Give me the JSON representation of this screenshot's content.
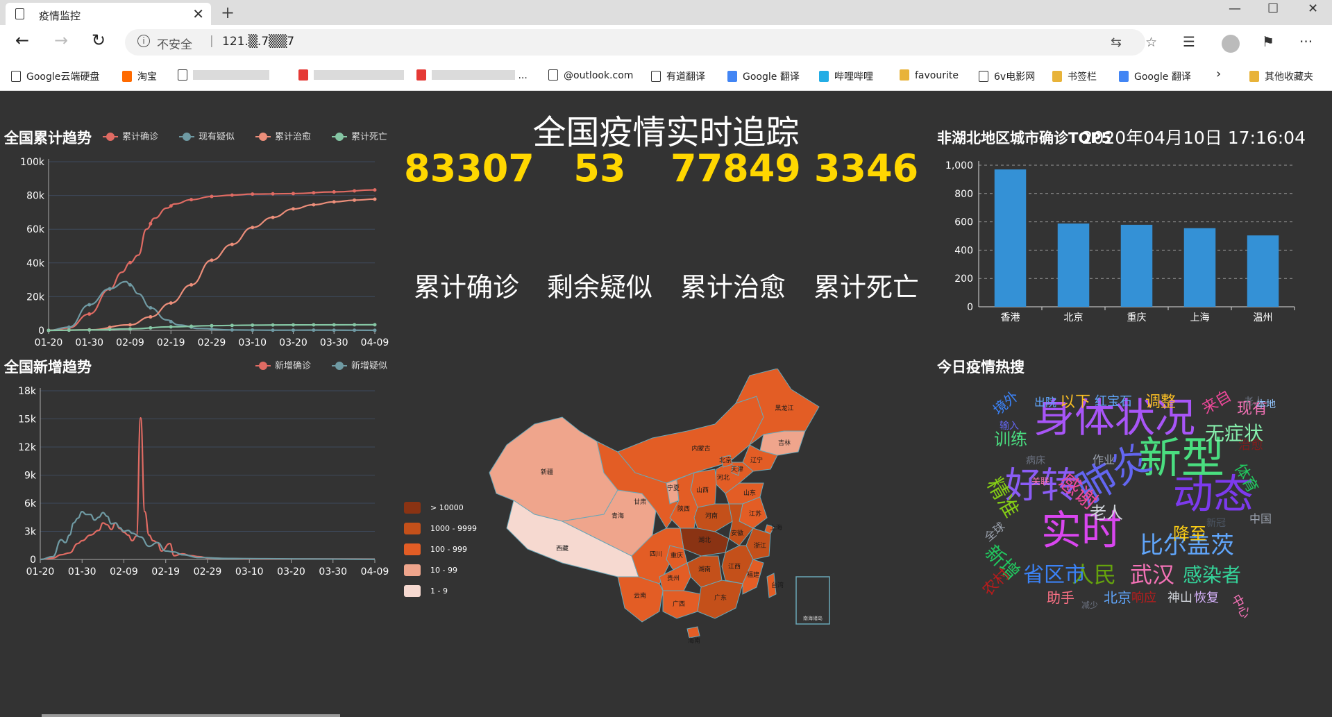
{
  "browser": {
    "tab_title": "疫情监控",
    "address": {
      "security": "不安全",
      "url": "121.▒.7▒▒7"
    },
    "bookmarks": [
      {
        "label": "Google云端硬盘",
        "icon": "doc-icon"
      },
      {
        "label": "淘宝",
        "icon": "taobao-icon"
      },
      {
        "label": "",
        "icon": "doc-icon",
        "redacted": true
      },
      {
        "label": "",
        "icon": "red-icon",
        "redacted": true
      },
      {
        "label": "...",
        "icon": "red-icon",
        "redacted": true
      },
      {
        "label": "@outlook.com",
        "icon": "doc-icon"
      },
      {
        "label": "有道翻译",
        "icon": "doc-icon"
      },
      {
        "label": "Google 翻译",
        "icon": "translate-icon"
      },
      {
        "label": "哔哩哔哩",
        "icon": "bilibili-icon"
      },
      {
        "label": "favourite",
        "icon": "folder-icon"
      },
      {
        "label": "6v电影网",
        "icon": "doc-icon"
      },
      {
        "label": "书签栏",
        "icon": "folder-icon"
      },
      {
        "label": "Google 翻译",
        "icon": "translate-icon"
      }
    ],
    "more_bookmarks": "其他收藏夹"
  },
  "header": {
    "title": "全国疫情实时追踪",
    "datetime": "2020年04月10日 17:16:04"
  },
  "stats": [
    {
      "value": "83307",
      "label": "累计确诊"
    },
    {
      "value": "53",
      "label": "剩余疑似"
    },
    {
      "value": "77849",
      "label": "累计治愈"
    },
    {
      "value": "3346",
      "label": "累计死亡"
    }
  ],
  "colors": {
    "confirmed": "#e06b63",
    "suspect": "#6f9aa3",
    "cured": "#ec8e7a",
    "dead": "#85c6a4",
    "bar": "#3491d6",
    "background": "#333333",
    "number": "#ffd700"
  },
  "panels": {
    "cumulative_title": "全国累计趋势",
    "daily_title": "全国新增趋势",
    "top5_title": "非湖北地区城市确诊TOP5",
    "hot_title": "今日疫情热搜"
  },
  "chart_data": [
    {
      "id": "cumulative",
      "type": "line",
      "title": "全国累计趋势",
      "x_ticks": [
        "01-20",
        "01-30",
        "02-09",
        "02-19",
        "02-29",
        "03-10",
        "03-20",
        "03-30",
        "04-09"
      ],
      "y_ticks": [
        "0",
        "20k",
        "40k",
        "60k",
        "80k",
        "100k"
      ],
      "ylim": [
        0,
        100000
      ],
      "xlim_days": [
        0,
        80
      ],
      "series": [
        {
          "name": "累计确诊",
          "color_key": "confirmed",
          "points": [
            [
              0,
              0
            ],
            [
              5,
              1500
            ],
            [
              10,
              9700
            ],
            [
              15,
              24500
            ],
            [
              18,
              34500
            ],
            [
              20,
              40200
            ],
            [
              22,
              44600
            ],
            [
              24,
              60000
            ],
            [
              26,
              66500
            ],
            [
              29,
              72500
            ],
            [
              31,
              75000
            ],
            [
              35,
              77500
            ],
            [
              40,
              79400
            ],
            [
              45,
              80200
            ],
            [
              50,
              80800
            ],
            [
              60,
              81100
            ],
            [
              70,
              82100
            ],
            [
              80,
              83300
            ]
          ]
        },
        {
          "name": "现有疑似",
          "color_key": "suspect",
          "points": [
            [
              0,
              0
            ],
            [
              5,
              1900
            ],
            [
              10,
              15200
            ],
            [
              15,
              24700
            ],
            [
              19,
              28900
            ],
            [
              20,
              27000
            ],
            [
              22,
              21700
            ],
            [
              25,
              13400
            ],
            [
              29,
              6200
            ],
            [
              32,
              3200
            ],
            [
              37,
              1100
            ],
            [
              45,
              250
            ],
            [
              55,
              100
            ],
            [
              65,
              150
            ],
            [
              80,
              53
            ]
          ]
        },
        {
          "name": "累计治愈",
          "color_key": "cured",
          "points": [
            [
              0,
              0
            ],
            [
              10,
              300
            ],
            [
              20,
              3300
            ],
            [
              25,
              8000
            ],
            [
              30,
              16200
            ],
            [
              35,
              27000
            ],
            [
              40,
              41600
            ],
            [
              45,
              51000
            ],
            [
              50,
              61000
            ],
            [
              55,
              67000
            ],
            [
              60,
              72000
            ],
            [
              65,
              74500
            ],
            [
              70,
              76200
            ],
            [
              75,
              77200
            ],
            [
              80,
              77800
            ]
          ]
        },
        {
          "name": "累计死亡",
          "color_key": "dead",
          "points": [
            [
              0,
              0
            ],
            [
              10,
              260
            ],
            [
              20,
              900
            ],
            [
              30,
              2100
            ],
            [
              40,
              2800
            ],
            [
              50,
              3100
            ],
            [
              60,
              3250
            ],
            [
              70,
              3300
            ],
            [
              80,
              3346
            ]
          ]
        }
      ]
    },
    {
      "id": "daily",
      "type": "line",
      "title": "全国新增趋势",
      "x_ticks": [
        "01-20",
        "01-30",
        "02-09",
        "02-19",
        "02-29",
        "03-10",
        "03-20",
        "03-30",
        "04-09"
      ],
      "y_ticks": [
        "0",
        "3k",
        "6k",
        "9k",
        "12k",
        "15k",
        "18k"
      ],
      "ylim": [
        0,
        18000
      ],
      "xlim_days": [
        0,
        80
      ],
      "series": [
        {
          "name": "新增确诊",
          "color_key": "confirmed",
          "points": [
            [
              0,
              0
            ],
            [
              3,
              150
            ],
            [
              5,
              500
            ],
            [
              7,
              700
            ],
            [
              9,
              1700
            ],
            [
              10,
              2000
            ],
            [
              12,
              2600
            ],
            [
              14,
              3100
            ],
            [
              15,
              3900
            ],
            [
              16,
              3700
            ],
            [
              17,
              3200
            ],
            [
              18,
              3900
            ],
            [
              19,
              3300
            ],
            [
              20,
              2900
            ],
            [
              21,
              2600
            ],
            [
              22,
              2000
            ],
            [
              23,
              2500
            ],
            [
              24,
              15100
            ],
            [
              25,
              5100
            ],
            [
              26,
              2600
            ],
            [
              27,
              2000
            ],
            [
              28,
              1800
            ],
            [
              29,
              900
            ],
            [
              31,
              1700
            ],
            [
              32,
              400
            ],
            [
              34,
              600
            ],
            [
              36,
              400
            ],
            [
              38,
              300
            ],
            [
              40,
              150
            ],
            [
              45,
              100
            ],
            [
              50,
              50
            ],
            [
              60,
              40
            ],
            [
              70,
              50
            ],
            [
              80,
              40
            ]
          ]
        },
        {
          "name": "新增疑似",
          "color_key": "suspect",
          "points": [
            [
              0,
              0
            ],
            [
              3,
              300
            ],
            [
              5,
              2100
            ],
            [
              6,
              1800
            ],
            [
              7,
              2600
            ],
            [
              8,
              3900
            ],
            [
              9,
              4400
            ],
            [
              10,
              5100
            ],
            [
              11,
              4800
            ],
            [
              12,
              4800
            ],
            [
              13,
              4200
            ],
            [
              14,
              4500
            ],
            [
              15,
              5000
            ],
            [
              16,
              4600
            ],
            [
              17,
              3800
            ],
            [
              18,
              3900
            ],
            [
              19,
              3400
            ],
            [
              20,
              3000
            ],
            [
              21,
              3100
            ],
            [
              22,
              2800
            ],
            [
              24,
              2400
            ],
            [
              26,
              1400
            ],
            [
              28,
              1800
            ],
            [
              30,
              900
            ],
            [
              32,
              800
            ],
            [
              34,
              500
            ],
            [
              38,
              200
            ],
            [
              45,
              100
            ],
            [
              60,
              60
            ],
            [
              70,
              40
            ],
            [
              80,
              20
            ]
          ]
        }
      ]
    },
    {
      "id": "top5",
      "type": "bar",
      "title": "非湖北地区城市确诊TOP5",
      "categories": [
        "香港",
        "北京",
        "重庆",
        "上海",
        "温州"
      ],
      "values": [
        970,
        588,
        579,
        555,
        504
      ],
      "y_ticks": [
        "0",
        "200",
        "400",
        "600",
        "800",
        "1,000"
      ],
      "ylim": [
        0,
        1000
      ]
    }
  ],
  "map": {
    "legend": [
      {
        "label": "> 10000",
        "color": "#8a3313"
      },
      {
        "label": "1000 - 9999",
        "color": "#c4501a"
      },
      {
        "label": "100 - 999",
        "color": "#e35d25"
      },
      {
        "label": "10 - 99",
        "color": "#efa58c"
      },
      {
        "label": "1 - 9",
        "color": "#f6d9d0"
      }
    ],
    "provinces": [
      {
        "name": "新疆",
        "level": 3
      },
      {
        "name": "西藏",
        "level": 4
      },
      {
        "name": "青海",
        "level": 3
      },
      {
        "name": "甘肃",
        "level": 2
      },
      {
        "name": "内蒙古",
        "level": 2
      },
      {
        "name": "黑龙江",
        "level": 2
      },
      {
        "name": "吉林",
        "level": 3
      },
      {
        "name": "辽宁",
        "level": 2
      },
      {
        "name": "北京",
        "level": 2
      },
      {
        "name": "天津",
        "level": 2
      },
      {
        "name": "河北",
        "level": 2
      },
      {
        "name": "山西",
        "level": 2
      },
      {
        "name": "宁夏",
        "level": 3
      },
      {
        "name": "陕西",
        "level": 2
      },
      {
        "name": "河南",
        "level": 1
      },
      {
        "name": "山东",
        "level": 2
      },
      {
        "name": "江苏",
        "level": 2
      },
      {
        "name": "安徽",
        "level": 1
      },
      {
        "name": "上海",
        "level": 2
      },
      {
        "name": "湖北",
        "level": 0
      },
      {
        "name": "四川",
        "level": 2
      },
      {
        "name": "重庆",
        "level": 2
      },
      {
        "name": "浙江",
        "level": 1
      },
      {
        "name": "湖南",
        "level": 1
      },
      {
        "name": "江西",
        "level": 1
      },
      {
        "name": "贵州",
        "level": 2
      },
      {
        "name": "云南",
        "level": 2
      },
      {
        "name": "广西",
        "level": 2
      },
      {
        "name": "广东",
        "level": 1
      },
      {
        "name": "福建",
        "level": 2
      },
      {
        "name": "台湾",
        "level": 2
      },
      {
        "name": "海南",
        "level": 2
      },
      {
        "name": "南海诸岛",
        "level": -1
      }
    ]
  },
  "wordcloud": [
    {
      "text": "身体状况",
      "color": "#a855f7",
      "size": 58
    },
    {
      "text": "新型",
      "color": "#4ade80",
      "size": 62
    },
    {
      "text": "动态",
      "color": "#7c3aed",
      "size": 58
    },
    {
      "text": "好转",
      "color": "#8b5cf6",
      "size": 52
    },
    {
      "text": "实时",
      "color": "#d946ef",
      "size": 58
    },
    {
      "text": "肺炎",
      "color": "#6366f1",
      "size": 56
    },
    {
      "text": "比尔盖茨",
      "color": "#60a5fa",
      "size": 34
    },
    {
      "text": "武汉",
      "color": "#f472b6",
      "size": 32
    },
    {
      "text": "人民",
      "color": "#65a30d",
      "size": 32
    },
    {
      "text": "省区市",
      "color": "#3b82f6",
      "size": 30
    },
    {
      "text": "感染者",
      "color": "#34d399",
      "size": 28
    },
    {
      "text": "无症状",
      "color": "#86efac",
      "size": 28
    },
    {
      "text": "感谢",
      "color": "#ec4899",
      "size": 30
    },
    {
      "text": "精准",
      "color": "#84cc16",
      "size": 30
    },
    {
      "text": "新增",
      "color": "#22c55e",
      "size": 28
    },
    {
      "text": "训练",
      "color": "#4ade80",
      "size": 24
    },
    {
      "text": "老人",
      "color": "#d1d5db",
      "size": 24
    },
    {
      "text": "降至",
      "color": "#facc15",
      "size": 24
    },
    {
      "text": "调整",
      "color": "#fbbf24",
      "size": 22
    },
    {
      "text": "现有",
      "color": "#f472b6",
      "size": 22
    },
    {
      "text": "体育",
      "color": "#22c55e",
      "size": 22
    },
    {
      "text": "来自",
      "color": "#ec4899",
      "size": 22
    },
    {
      "text": "以下",
      "color": "#fbbf24",
      "size": 22
    },
    {
      "text": "红宝石",
      "color": "#60a5fa",
      "size": 18
    },
    {
      "text": "出院",
      "color": "#60a5fa",
      "size": 16
    },
    {
      "text": "本地",
      "color": "#93c5fd",
      "size": 14
    },
    {
      "text": "老人",
      "color": "#6b7280",
      "size": 14
    },
    {
      "text": "作业",
      "color": "#9ca3af",
      "size": 16
    },
    {
      "text": "病床",
      "color": "#6b7280",
      "size": 14
    },
    {
      "text": "关联",
      "color": "#f472b6",
      "size": 13
    },
    {
      "text": "中国",
      "color": "#9ca3af",
      "size": 16
    },
    {
      "text": "新冠",
      "color": "#4b5563",
      "size": 14
    },
    {
      "text": "全球",
      "color": "#9ca3af",
      "size": 16
    },
    {
      "text": "农村",
      "color": "#b91c1c",
      "size": 22
    },
    {
      "text": "助手",
      "color": "#fb7185",
      "size": 20
    },
    {
      "text": "减少",
      "color": "#6b7280",
      "size": 12
    },
    {
      "text": "北京",
      "color": "#60a5fa",
      "size": 20
    },
    {
      "text": "响应",
      "color": "#b91c1c",
      "size": 18
    },
    {
      "text": "神山",
      "color": "#d1d5db",
      "size": 18
    },
    {
      "text": "恢复",
      "color": "#d8b4fe",
      "size": 18
    },
    {
      "text": "中心",
      "color": "#f472b6",
      "size": 18
    },
    {
      "text": "境外",
      "color": "#3b82f6",
      "size": 20
    },
    {
      "text": "输入",
      "color": "#6366f1",
      "size": 14
    },
    {
      "text": "治愈",
      "color": "#7f1d1d",
      "size": 18
    }
  ]
}
